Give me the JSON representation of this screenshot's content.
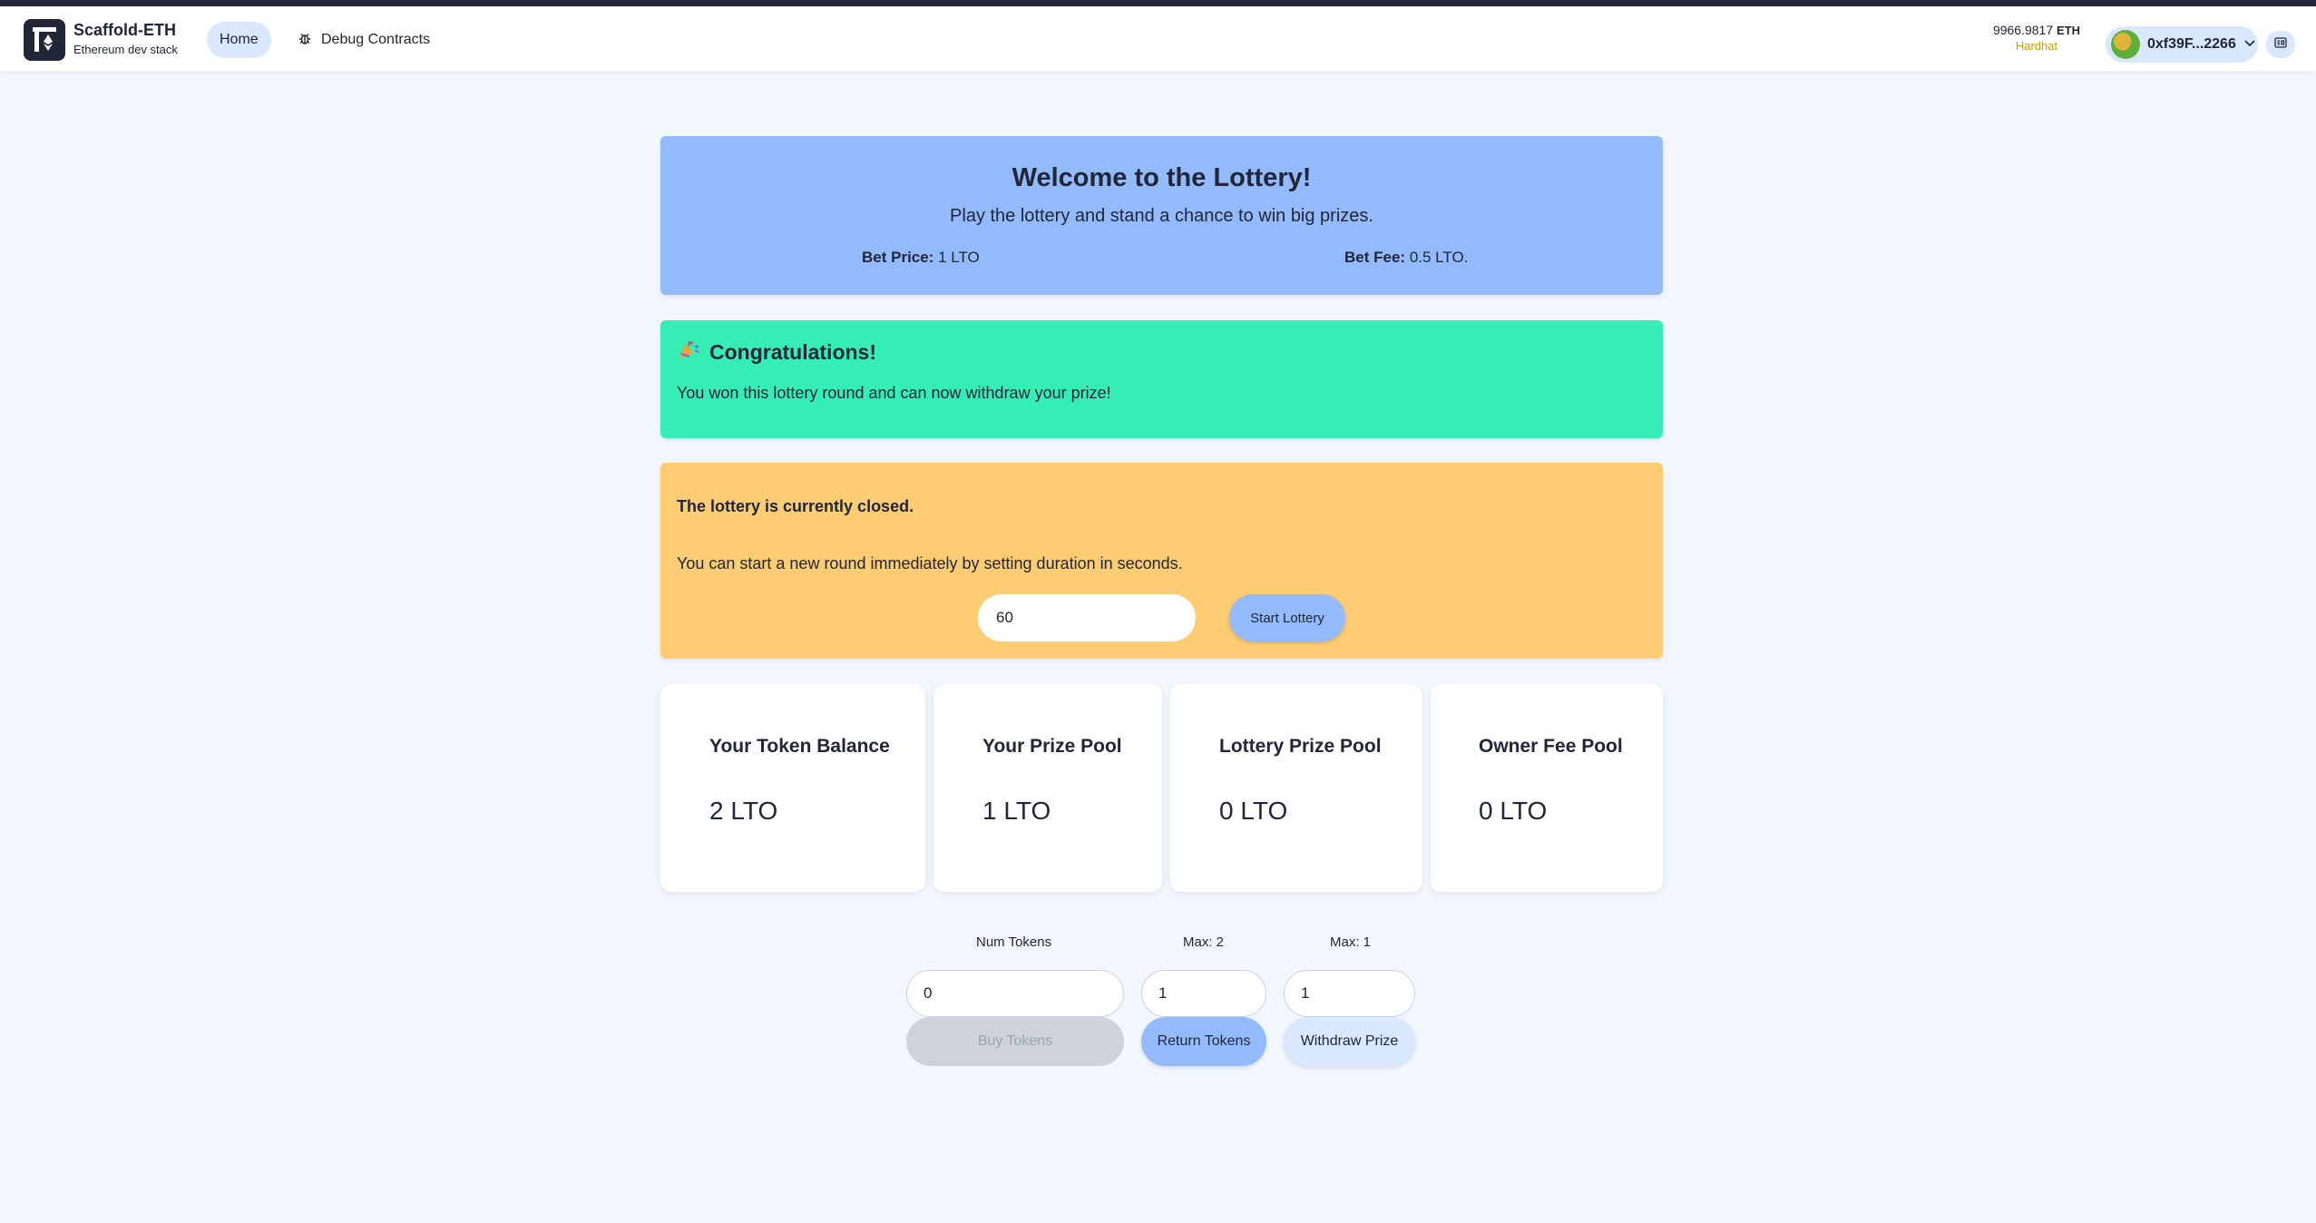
{
  "header": {
    "app_name": "Scaffold-ETH",
    "app_subtitle": "Ethereum dev stack",
    "nav_home": "Home",
    "nav_debug": "Debug Contracts",
    "balance_amount": "9966.9817",
    "balance_unit": "ETH",
    "network": "Hardhat",
    "account_address": "0xf39F...2266"
  },
  "welcome": {
    "title": "Welcome to the Lottery!",
    "subtitle": "Play the lottery and stand a chance to win big prizes.",
    "bet_price_label": "Bet Price:",
    "bet_price_value": "1 LTO",
    "bet_fee_label": "Bet Fee:",
    "bet_fee_value": "0.5 LTO."
  },
  "congrats": {
    "title": "Congratulations!",
    "text": "You won this lottery round and can now withdraw your prize!"
  },
  "closed": {
    "title": "The lottery is currently closed.",
    "text": "You can start a new round immediately by setting duration in seconds.",
    "duration_value": "60",
    "start_button": "Start Lottery"
  },
  "stats": [
    {
      "label": "Your Token Balance",
      "value": "2 LTO"
    },
    {
      "label": "Your Prize Pool",
      "value": "1 LTO"
    },
    {
      "label": "Lottery Prize Pool",
      "value": "0 LTO"
    },
    {
      "label": "Owner Fee Pool",
      "value": "0 LTO"
    }
  ],
  "actions": {
    "buy_label": "Num Tokens",
    "buy_value": "0",
    "buy_button": "Buy Tokens",
    "return_label": "Max: 2",
    "return_value": "1",
    "return_button": "Return Tokens",
    "withdraw_label": "Max: 1",
    "withdraw_value": "1",
    "withdraw_button": "Withdraw Prize"
  },
  "colors": {
    "primary": "#93bbfb",
    "secondary": "#dae8ff",
    "success": "#34eeb6",
    "warning": "#fecc72",
    "disabled": "#ced2d9",
    "background": "#f2f7fe"
  }
}
